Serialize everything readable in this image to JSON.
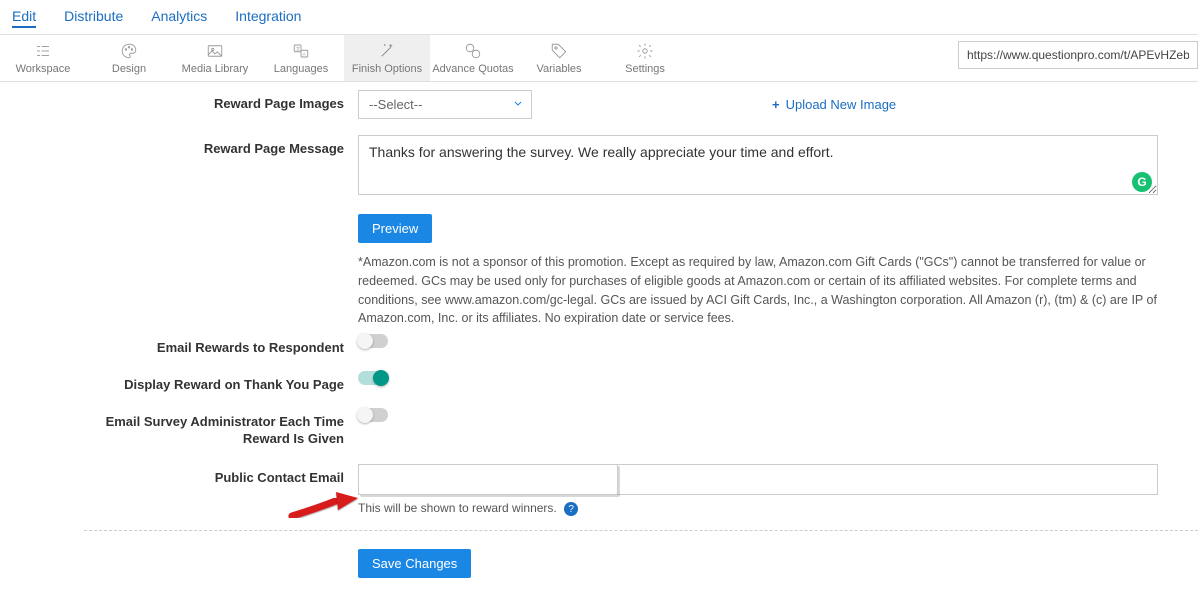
{
  "topnav": {
    "items": [
      "Edit",
      "Distribute",
      "Analytics",
      "Integration"
    ],
    "active_index": 0
  },
  "toolbar": {
    "items": [
      {
        "id": "workspace",
        "label": "Workspace"
      },
      {
        "id": "design",
        "label": "Design"
      },
      {
        "id": "media-library",
        "label": "Media Library"
      },
      {
        "id": "languages",
        "label": "Languages"
      },
      {
        "id": "finish-options",
        "label": "Finish Options"
      },
      {
        "id": "advance-quotas",
        "label": "Advance Quotas"
      },
      {
        "id": "variables",
        "label": "Variables"
      },
      {
        "id": "settings",
        "label": "Settings"
      }
    ],
    "active_id": "finish-options",
    "url": "https://www.questionpro.com/t/APEvHZeb"
  },
  "form": {
    "reward_images_label": "Reward Page Images",
    "reward_images_value": "--Select--",
    "upload_link": "Upload New Image",
    "reward_message_label": "Reward Page Message",
    "reward_message_value": "Thanks for answering the survey. We really appreciate your time and effort.",
    "preview_button": "Preview",
    "disclaimer": "*Amazon.com is not a sponsor of this promotion. Except as required by law, Amazon.com Gift Cards (\"GCs\") cannot be transferred for value or redeemed. GCs may be used only for purchases of eligible goods at Amazon.com or certain of its affiliated websites. For complete terms and conditions, see www.amazon.com/gc-legal. GCs are issued by ACI Gift Cards, Inc., a Washington corporation. All Amazon (r), (tm) & (c) are IP of Amazon.com, Inc. or its affiliates. No expiration date or service fees.",
    "email_rewards_label": "Email Rewards to Respondent",
    "email_rewards_on": false,
    "display_reward_label": "Display Reward on Thank You Page",
    "display_reward_on": true,
    "email_admin_label": "Email Survey Administrator Each Time Reward Is Given",
    "email_admin_on": false,
    "public_contact_label": "Public Contact Email",
    "public_contact_value": "",
    "public_contact_helper": "This will be shown to reward winners.",
    "save_button": "Save Changes"
  }
}
